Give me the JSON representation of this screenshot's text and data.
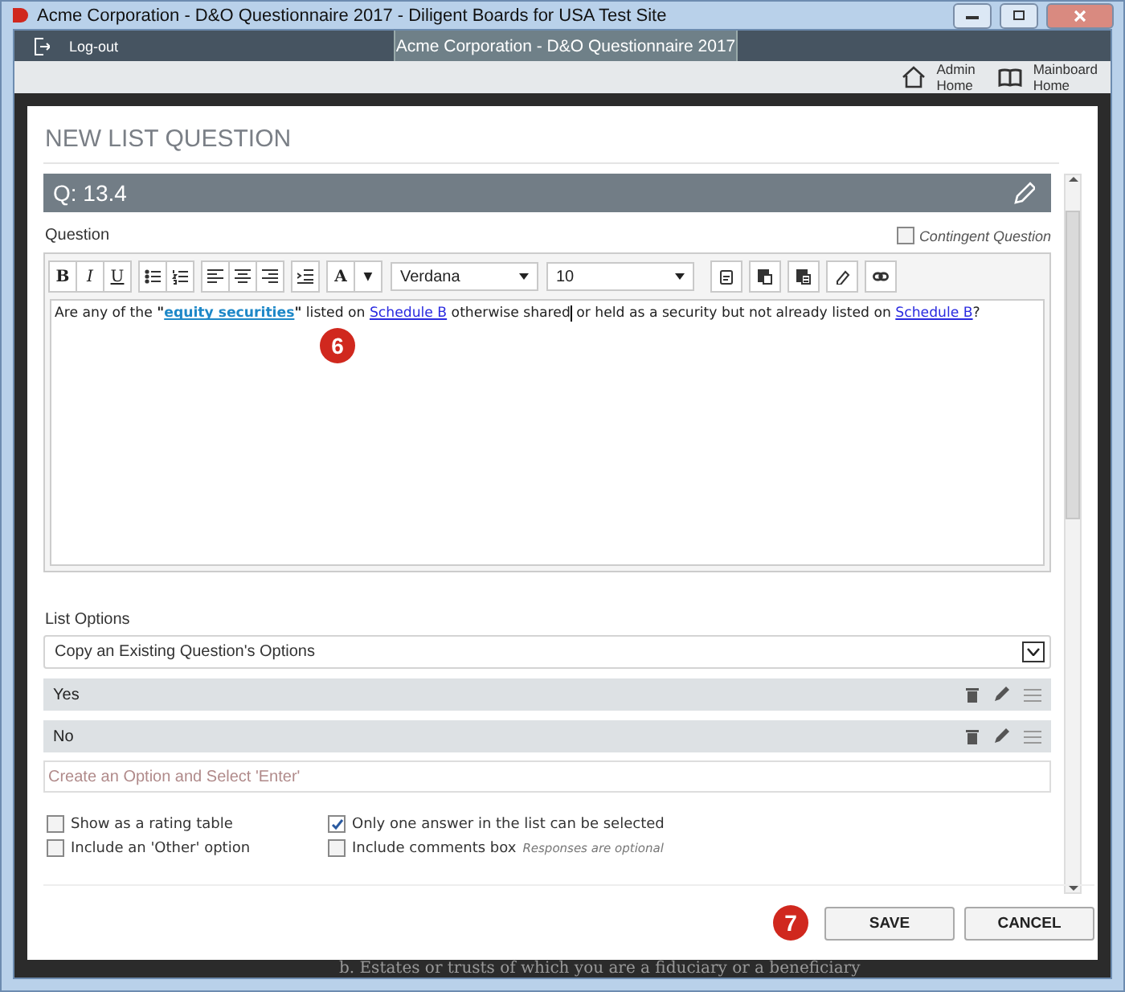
{
  "window": {
    "title": "Acme Corporation - D&O Questionnaire 2017 - Diligent Boards for USA Test Site"
  },
  "nav": {
    "logout": "Log-out",
    "active_tab": "Acme Corporation - D&O Questionnaire 2017"
  },
  "shortcuts": [
    {
      "kind": "home",
      "lines": [
        "Admin",
        "Home"
      ]
    },
    {
      "kind": "book",
      "lines": [
        "Mainboard",
        "Home"
      ]
    }
  ],
  "dialog": {
    "title": "NEW LIST QUESTION",
    "question_number": "Q: 13.4",
    "question_label": "Question",
    "contingent": {
      "label": "Contingent Question",
      "checked": false
    },
    "toolbar": [
      [
        {
          "kind": "bold",
          "label": "B"
        },
        {
          "kind": "italic",
          "label": "I"
        },
        {
          "kind": "underline",
          "label": "U"
        }
      ],
      [
        {
          "kind": "bullets"
        },
        {
          "kind": "numbers"
        }
      ],
      [
        {
          "kind": "align-left"
        },
        {
          "kind": "align-center"
        },
        {
          "kind": "align-right"
        }
      ],
      [
        {
          "kind": "indent"
        }
      ],
      [
        {
          "kind": "color",
          "label": "A"
        },
        {
          "kind": "caret",
          "label": "▼"
        }
      ]
    ],
    "font": "Verdana",
    "size": "10",
    "tools": [
      {
        "kind": "paste-text"
      },
      {
        "kind": "paste"
      },
      {
        "kind": "paste-word"
      },
      {
        "kind": "eraser"
      },
      {
        "kind": "link"
      }
    ],
    "question_text": [
      {
        "kind": "plain",
        "text": "Are any of the "
      },
      {
        "kind": "bold",
        "text": "\""
      },
      {
        "kind": "term",
        "text": "equity securities"
      },
      {
        "kind": "bold",
        "text": "\""
      },
      {
        "kind": "plain",
        "text": " listed on "
      },
      {
        "kind": "link",
        "text": "Schedule B"
      },
      {
        "kind": "plain",
        "text": " otherwise shared"
      },
      {
        "kind": "cursor"
      },
      {
        "kind": "plain",
        "text": " or held as a security but not already listed on "
      },
      {
        "kind": "link",
        "text": "Schedule B"
      },
      {
        "kind": "plain",
        "text": "?"
      }
    ],
    "editor_annotation": "6",
    "list_options_label": "List Options",
    "copy_select": "Copy an Existing Question's Options",
    "options": [
      {
        "label": "Yes"
      },
      {
        "label": "No"
      }
    ],
    "new_option_placeholder": "Create an Option and Select 'Enter'",
    "settings": [
      {
        "label": "Show as a rating table",
        "checked": false
      },
      {
        "label": "Only one answer in the list can be selected",
        "checked": true
      },
      {
        "label": "Include an 'Other' option",
        "checked": false
      },
      {
        "label": "Include comments box",
        "checked": false,
        "note": "Responses are optional"
      }
    ],
    "buttons": [
      {
        "label": "SAVE"
      },
      {
        "label": "CANCEL"
      }
    ],
    "buttons_annotation": "7"
  },
  "background_text": "b. Estates or trusts of which you are a fiduciary or a beneficiary"
}
